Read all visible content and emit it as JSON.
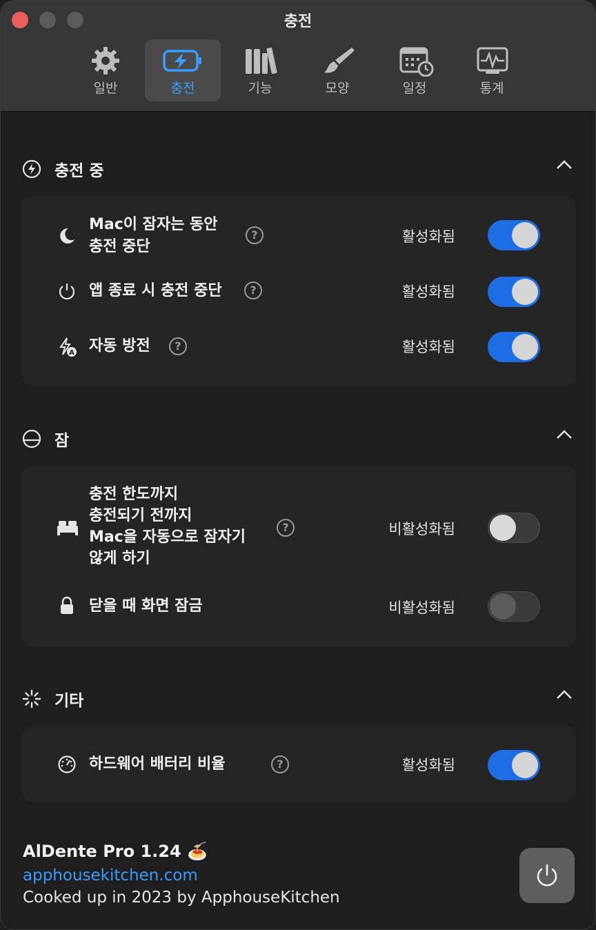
{
  "window": {
    "title": "충전"
  },
  "tabs": [
    {
      "label": "일반",
      "icon": "gear-icon"
    },
    {
      "label": "충전",
      "icon": "battery-charging-icon",
      "active": true
    },
    {
      "label": "기능",
      "icon": "books-icon"
    },
    {
      "label": "모양",
      "icon": "paintbrush-icon"
    },
    {
      "label": "일정",
      "icon": "calendar-clock-icon"
    },
    {
      "label": "통계",
      "icon": "waveform-chart-icon"
    }
  ],
  "sections": {
    "charging": {
      "title": "충전 중",
      "icon": "bolt-circle-icon",
      "rows": [
        {
          "label_line1": "Mac이 잠자는 동안",
          "label_line2": "충전 중단",
          "status": "활성화됨",
          "icon": "moon-icon",
          "enabled": true
        },
        {
          "label": "앱 종료 시 충전 중단",
          "status": "활성화됨",
          "icon": "power-icon",
          "enabled": true
        },
        {
          "label": "자동 방전",
          "status": "활성화됨",
          "icon": "bolt-a-icon",
          "enabled": true
        }
      ]
    },
    "sleep": {
      "title": "잠",
      "icon": "sleep-circle-icon",
      "rows": [
        {
          "label_line1": "충전 한도까지",
          "label_line2": "충전되기 전까지",
          "label_line3": "Mac을 자동으로 잠자기",
          "label_line4": "않게 하기",
          "status": "비활성화됨",
          "icon": "bed-icon",
          "enabled": false
        },
        {
          "label": "닫을 때 화면 잠금",
          "status": "비활성화됨",
          "icon": "lock-icon",
          "enabled": false
        }
      ]
    },
    "other": {
      "title": "기타",
      "icon": "spinner-icon",
      "rows": [
        {
          "label": "하드웨어 배터리 비율",
          "status": "활성화됨",
          "icon": "gauge-icon",
          "enabled": true
        }
      ]
    }
  },
  "help_glyph": "?",
  "footer": {
    "app_name": "AlDente Pro 1.24 🍝",
    "website": "apphousekitchen.com",
    "credit": "Cooked up in 2023 by ApphouseKitchen"
  },
  "colors": {
    "accent": "#1d6ee5",
    "link": "#3b9cff",
    "close": "#ec5e5a"
  }
}
